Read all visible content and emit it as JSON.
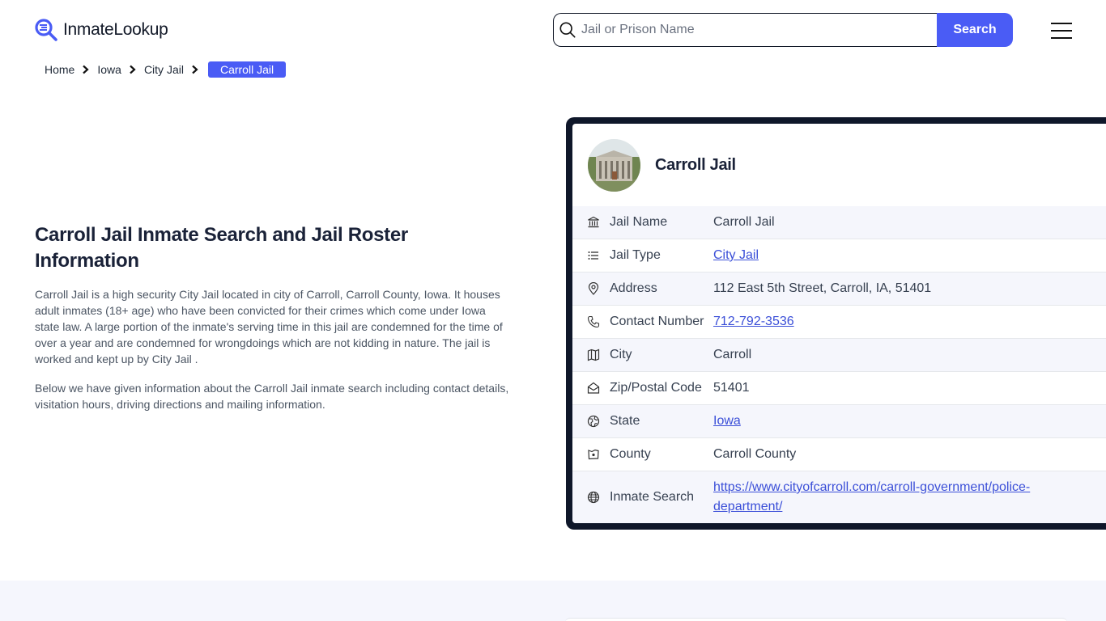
{
  "header": {
    "logo_text": "InmateLookup",
    "search": {
      "placeholder": "Jail or Prison Name",
      "value": "",
      "button_label": "Search"
    },
    "menu_icon": "hamburger-icon"
  },
  "breadcrumb": {
    "items": [
      "Home",
      "Iowa",
      "City Jail"
    ],
    "current": "Carroll Jail"
  },
  "main": {
    "title": "Carroll Jail Inmate Search and Jail Roster Information",
    "paragraphs": [
      "Carroll Jail is a high security City Jail located in city of Carroll, Carroll County, Iowa. It houses adult inmates (18+ age) who have been convicted for their crimes which come under Iowa state law. A large portion of the inmate's serving time in this jail are condemned for the time of over a year and are condemned for wrongdoings which are not kidding in nature. The jail is worked and kept up by City Jail .",
      "Below we have given information about the Carroll Jail inmate search including contact details, visitation hours, driving directions and mailing information."
    ]
  },
  "card": {
    "title": "Carroll Jail",
    "rows": [
      {
        "icon": "building-icon",
        "label": "Jail Name",
        "value": "Carroll Jail",
        "link": false
      },
      {
        "icon": "list-icon",
        "label": "Jail Type",
        "value": "City Jail",
        "link": true
      },
      {
        "icon": "map-pin-icon",
        "label": "Address",
        "value": "112 East 5th Street, Carroll, IA, 51401",
        "link": false
      },
      {
        "icon": "phone-icon",
        "label": "Contact Number",
        "value": "712-792-3536",
        "link": true
      },
      {
        "icon": "map-icon",
        "label": "City",
        "value": "Carroll",
        "link": false
      },
      {
        "icon": "mail-icon",
        "label": "Zip/Postal Code",
        "value": "51401",
        "link": false
      },
      {
        "icon": "globe-region-icon",
        "label": "State",
        "value": "Iowa",
        "link": true
      },
      {
        "icon": "county-icon",
        "label": "County",
        "value": "Carroll County",
        "link": false
      },
      {
        "icon": "globe-icon",
        "label": "Inmate Search",
        "value": "https://www.cityofcarroll.com/carroll-government/police-department/",
        "link": true
      }
    ]
  },
  "colors": {
    "accent": "#4a5cf5",
    "card_border": "#0f172a",
    "link": "#3b4fd8",
    "row_alt": "#f5f6fc"
  }
}
